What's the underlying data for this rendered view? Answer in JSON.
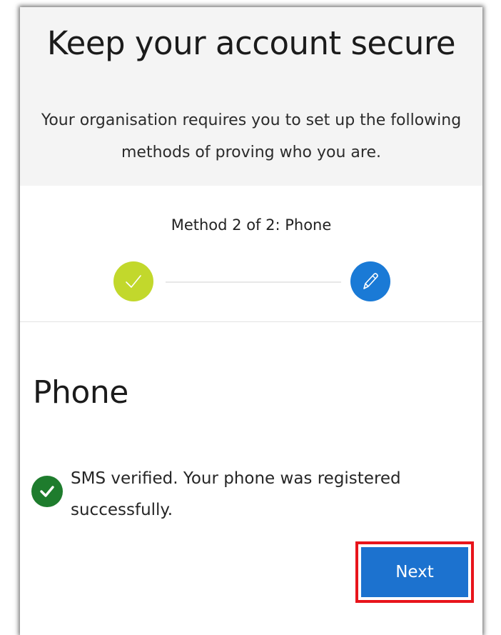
{
  "header": {
    "title": "Keep your account secure",
    "subtitle_line1": "Your organisation requires you to set up the following",
    "subtitle_line2": "methods of proving who you are."
  },
  "progress": {
    "label": "Method 2 of 2: Phone",
    "current_step": 2,
    "total_steps": 2,
    "steps": [
      {
        "status": "completed",
        "icon": "checkmark-icon",
        "color": "#c2d82c"
      },
      {
        "status": "current",
        "icon": "pencil-icon",
        "color": "#1a7ad6"
      }
    ]
  },
  "section": {
    "title": "Phone"
  },
  "status": {
    "icon": "success-check-icon",
    "color": "#1e7c2d",
    "line1": "SMS verified. Your phone was registered",
    "line2": "successfully."
  },
  "actions": {
    "next_label": "Next",
    "next_color": "#1c72cf",
    "highlight_color": "#e8141b"
  }
}
